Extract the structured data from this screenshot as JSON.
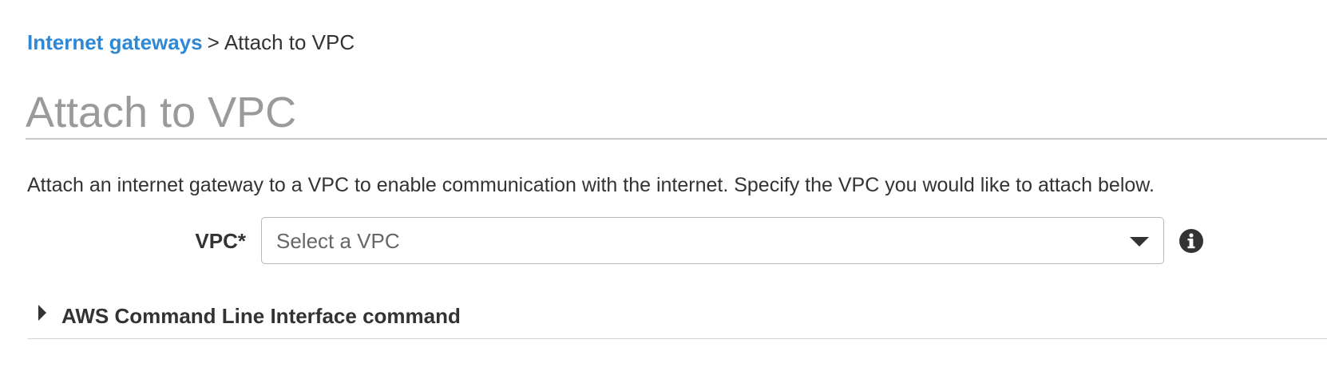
{
  "breadcrumb": {
    "link_label": "Internet gateways",
    "separator": ">",
    "current_label": "Attach to VPC"
  },
  "page": {
    "title": "Attach to VPC",
    "description": "Attach an internet gateway to a VPC to enable communication with the internet. Specify the VPC you would like to attach below."
  },
  "form": {
    "vpc_label": "VPC*",
    "vpc_placeholder": "Select a VPC",
    "vpc_selected_value": "",
    "info_icon": "info-circle-icon",
    "dropdown_icon": "chevron-down-icon"
  },
  "cli_section": {
    "label": "AWS Command Line Interface command",
    "expanded": false,
    "expander_icon": "caret-right-icon"
  },
  "colors": {
    "link": "#2f88d6",
    "title": "#9a9a9a",
    "text": "#333333",
    "placeholder": "#666666",
    "border": "#b8b8b8"
  }
}
